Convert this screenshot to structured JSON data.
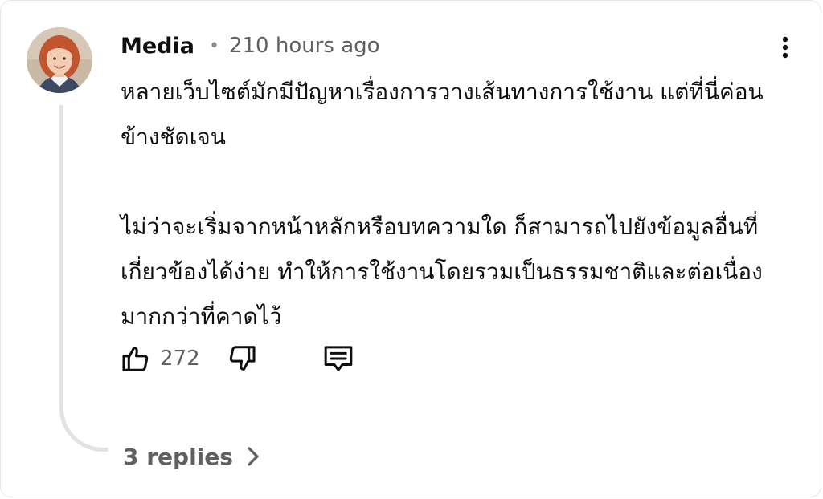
{
  "comment": {
    "author": "Media",
    "separator": "•",
    "timestamp": "210 hours ago",
    "paragraphs": [
      "หลายเว็บไซต์มักมีปัญหาเรื่องการวางเส้นทางการใช้งาน แต่ที่นี่ค่อนข้างชัดเจน",
      "ไม่ว่าจะเริ่มจากหน้าหลักหรือบทความใด ก็สามารถไปยังข้อมูลอื่นที่เกี่ยวข้องได้ง่าย ทำให้การใช้งานโดยรวมเป็นธรรมชาติและต่อเนื่องมากกว่าที่คาดไว้"
    ],
    "like_count": "272",
    "replies_label": "3 replies"
  },
  "icons": {
    "more": "more-vertical-icon",
    "like": "thumb-up-icon",
    "dislike": "thumb-down-icon",
    "reply": "comment-icon",
    "expand": "chevron-right-icon"
  },
  "colors": {
    "text_primary": "#0f0f0f",
    "text_secondary": "#606060",
    "thread_line": "#e2e2e2",
    "avatar_hair": "#c0552f"
  }
}
